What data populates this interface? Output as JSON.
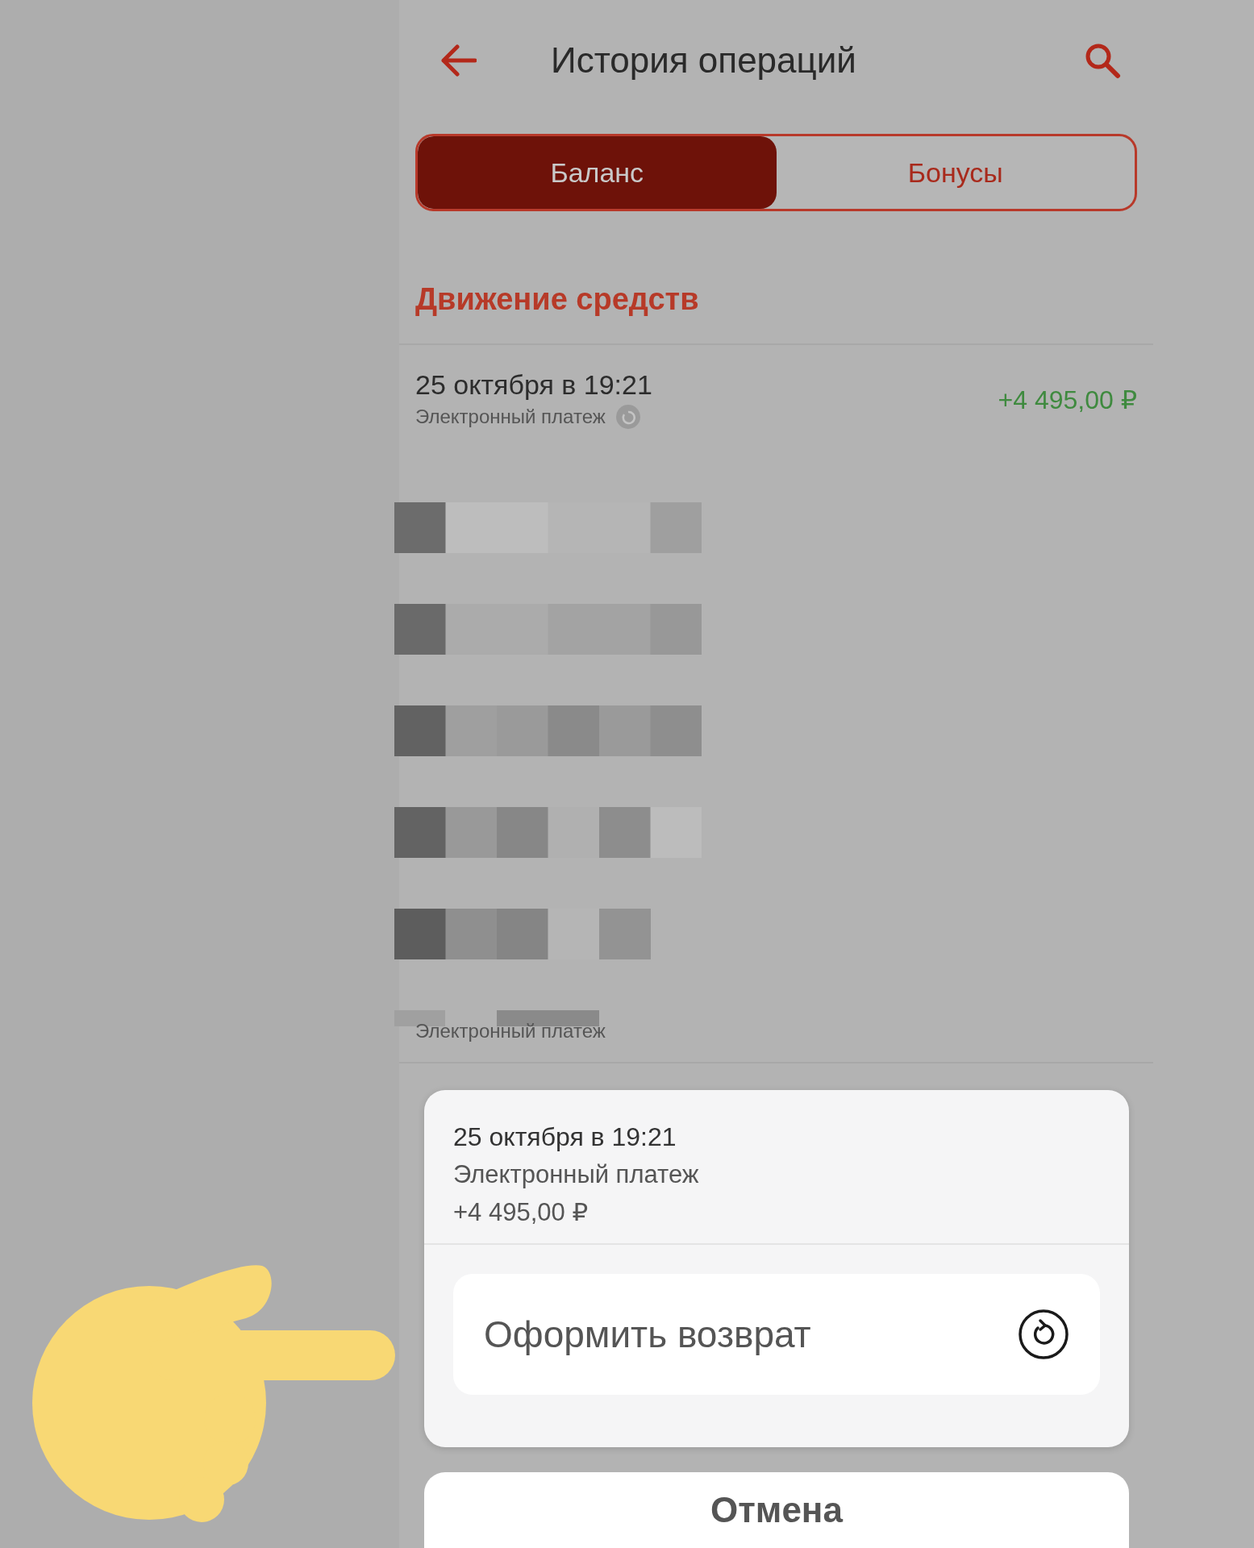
{
  "header": {
    "title": "История операций"
  },
  "tabs": [
    {
      "label": "Баланс",
      "selected": true
    },
    {
      "label": "Бонусы",
      "selected": false
    }
  ],
  "section_title": "Движение средств",
  "operations": [
    {
      "date": "25 октября в 19:21",
      "type": "Электронный платеж",
      "amount": "+4 495,00 ₽",
      "kind": "income"
    }
  ],
  "obscured_row": {
    "type": "Электронный платеж"
  },
  "action_sheet": {
    "date": "25 октября в 19:21",
    "type": "Электронный платеж",
    "amount": "+4 495,00 ₽",
    "actions": [
      {
        "label": "Оформить возврат"
      }
    ],
    "cancel": "Отмена"
  }
}
